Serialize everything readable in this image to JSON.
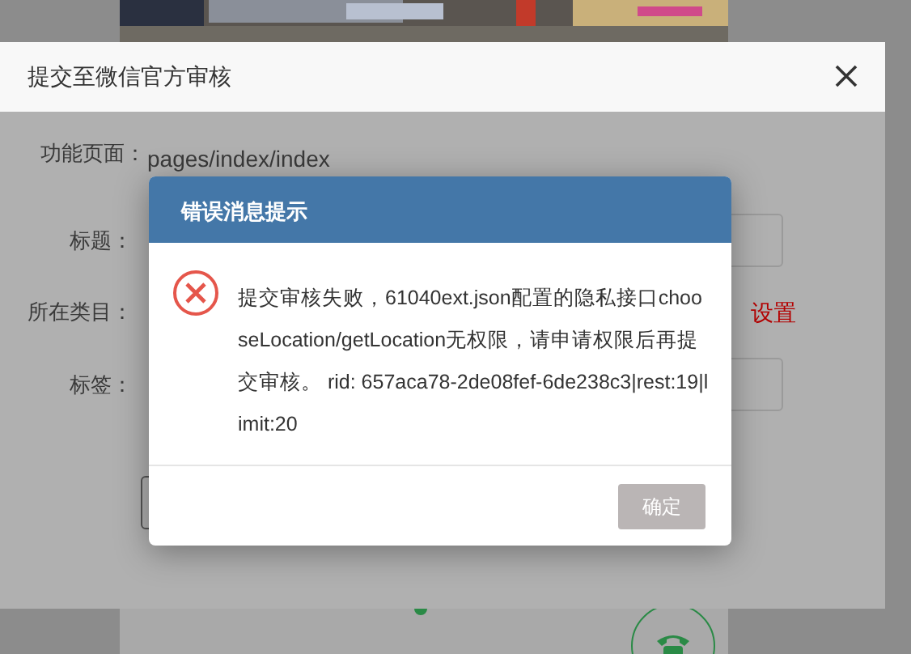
{
  "dialog": {
    "title": "提交至微信官方审核",
    "fields": [
      {
        "kind": "text",
        "label": "功能页面：",
        "value": "pages/index/index"
      },
      {
        "kind": "input",
        "label": "标题："
      },
      {
        "kind": "link",
        "label": "所在类目：",
        "link": "设置"
      },
      {
        "kind": "input",
        "label": "标签："
      }
    ]
  },
  "error": {
    "title": "错误消息提示",
    "message": "提交审核失败，61040ext.json配置的隐私接口chooseLocation/getLocation无权限，请申请权限后再提交审核。 rid: 657aca78-2de08fef-6de238c3|rest:19|limit:20",
    "button": "确定"
  }
}
